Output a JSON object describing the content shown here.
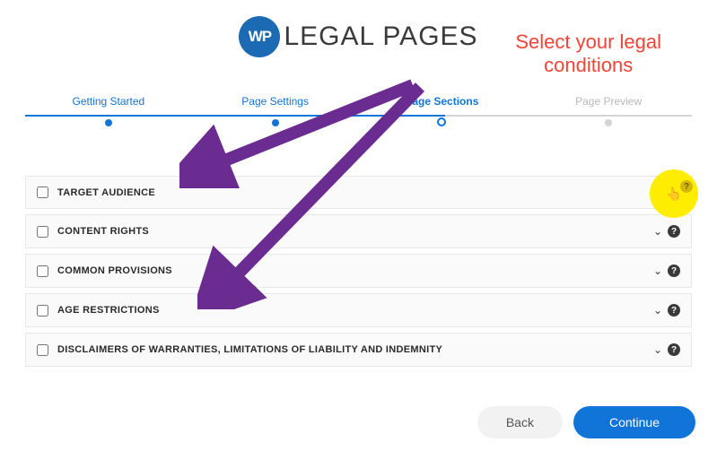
{
  "brand": {
    "badge_text": "WP",
    "name": "LEGAL PAGES"
  },
  "annotation": {
    "line1": "Select your legal",
    "line2": "conditions"
  },
  "stepper": {
    "steps": [
      {
        "label": "Getting Started",
        "state": "done"
      },
      {
        "label": "Page Settings",
        "state": "done"
      },
      {
        "label": "Page Sections",
        "state": "current"
      },
      {
        "label": "Page Preview",
        "state": "inactive"
      }
    ]
  },
  "sections": [
    {
      "title": "TARGET AUDIENCE",
      "highlighted": true
    },
    {
      "title": "CONTENT RIGHTS",
      "highlighted": false
    },
    {
      "title": "COMMON PROVISIONS",
      "highlighted": false
    },
    {
      "title": "AGE RESTRICTIONS",
      "highlighted": false
    },
    {
      "title": "DISCLAIMERS OF WARRANTIES, LIMITATIONS OF LIABILITY AND INDEMNITY",
      "highlighted": false
    }
  ],
  "buttons": {
    "back": "Back",
    "continue": "Continue"
  },
  "colors": {
    "primary": "#1074d8",
    "annotation": "#f44336",
    "arrow": "#6a2c91",
    "highlight": "#ffed00"
  }
}
